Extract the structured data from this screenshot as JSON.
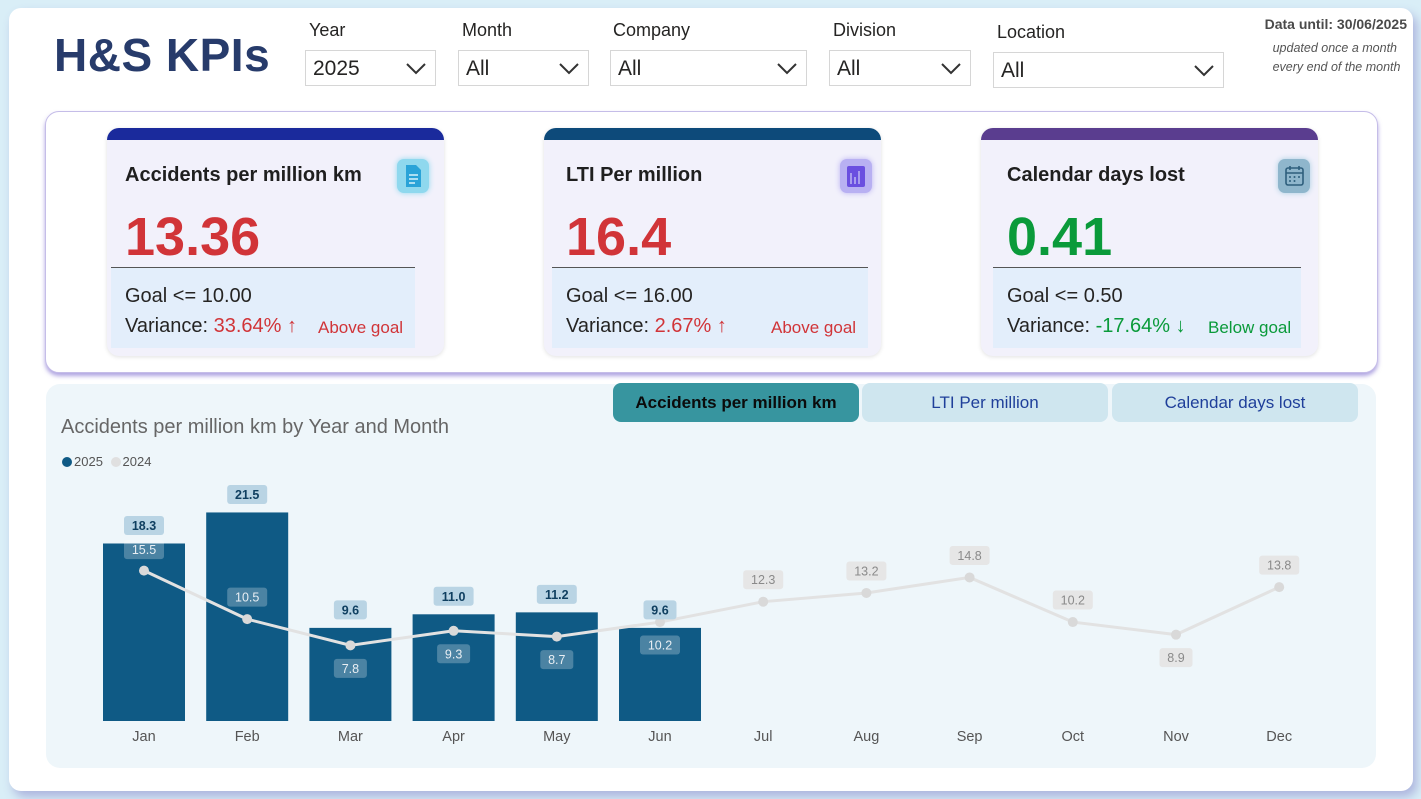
{
  "header": {
    "title": "H&S KPIs",
    "data_until": "Data until: 30/06/2025",
    "update_note_1": "updated once a month",
    "update_note_2": "every end of the month"
  },
  "filters": {
    "year": {
      "label": "Year",
      "value": "2025"
    },
    "month": {
      "label": "Month",
      "value": "All"
    },
    "company": {
      "label": "Company",
      "value": "All"
    },
    "division": {
      "label": "Division",
      "value": "All"
    },
    "location": {
      "label": "Location",
      "value": "All"
    }
  },
  "kpis": [
    {
      "title": "Accidents per million km",
      "value": "13.36",
      "goal": "Goal <= 10.00",
      "variance_label": "Variance:",
      "variance": "33.64%",
      "arrow": "↑",
      "status": "Above goal",
      "value_color": "#d13438",
      "bar_color": "#1a2a9c",
      "icon": "document-icon"
    },
    {
      "title": "LTI Per million",
      "value": "16.4",
      "goal": "Goal <= 16.00",
      "variance_label": "Variance:",
      "variance": "2.67%",
      "arrow": "↑",
      "status": "Above goal",
      "value_color": "#d13438",
      "bar_color": "#0d4a7a",
      "icon": "bar-chart-icon"
    },
    {
      "title": "Calendar days lost",
      "value": "0.41",
      "goal": "Goal <= 0.50",
      "variance_label": "Variance:",
      "variance": "-17.64%",
      "arrow": "↓",
      "status": "Below goal",
      "value_color": "#0a9a3a",
      "bar_color": "#5a3d8f",
      "icon": "calendar-icon"
    }
  ],
  "tabs": [
    {
      "label": "Accidents per million km",
      "active": true
    },
    {
      "label": "LTI Per million",
      "active": false
    },
    {
      "label": "Calendar days lost",
      "active": false
    }
  ],
  "chart": {
    "title": "Accidents per million km by Year and Month",
    "legend": [
      {
        "name": "2025",
        "color": "#0f5a85"
      },
      {
        "name": "2024",
        "color": "#e0e0e0"
      }
    ]
  },
  "chart_data": {
    "type": "bar",
    "title": "Accidents per million km by Year and Month",
    "categories": [
      "Jan",
      "Feb",
      "Mar",
      "Apr",
      "May",
      "Jun",
      "Jul",
      "Aug",
      "Sep",
      "Oct",
      "Nov",
      "Dec"
    ],
    "series": [
      {
        "name": "2025",
        "type": "bar",
        "values": [
          18.3,
          21.5,
          9.6,
          11.0,
          11.2,
          9.6,
          null,
          null,
          null,
          null,
          null,
          null
        ],
        "labels": [
          "18.3",
          "21.5",
          "9.6",
          "11.0",
          "11.2",
          "9.6"
        ]
      },
      {
        "name": "2024",
        "type": "line",
        "values": [
          15.5,
          10.5,
          7.8,
          9.3,
          8.7,
          10.2,
          12.3,
          13.2,
          14.8,
          10.2,
          8.9,
          13.8
        ],
        "labels": [
          "15.5",
          "10.5",
          "7.8",
          "9.3",
          "8.7",
          "10.2",
          "12.3",
          "13.2",
          "14.8",
          "10.2",
          "8.9",
          "13.8"
        ]
      }
    ],
    "ylim": [
      0,
      23
    ],
    "grid": false,
    "legend_position": "top-left"
  }
}
